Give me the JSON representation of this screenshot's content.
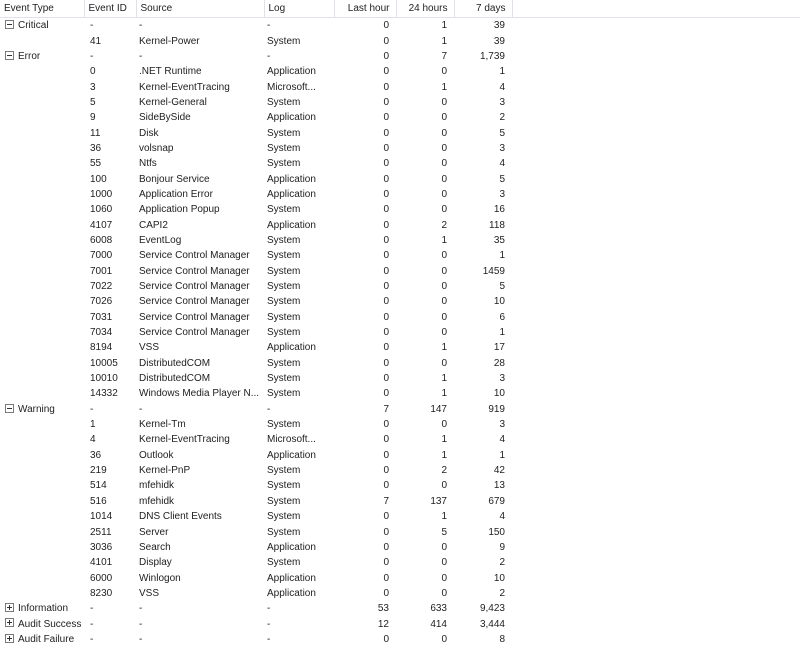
{
  "columns": [
    "Event Type",
    "Event ID",
    "Source",
    "Log",
    "Last hour",
    "24 hours",
    "7 days"
  ],
  "groups": [
    {
      "type": "Critical",
      "expanded": true,
      "summary": {
        "id": "-",
        "source": "-",
        "log": "-",
        "last_hour": "0",
        "h24": "1",
        "d7": "39"
      },
      "rows": [
        {
          "id": "41",
          "source": "Kernel-Power",
          "log": "System",
          "last_hour": "0",
          "h24": "1",
          "d7": "39"
        }
      ]
    },
    {
      "type": "Error",
      "expanded": true,
      "summary": {
        "id": "-",
        "source": "-",
        "log": "-",
        "last_hour": "0",
        "h24": "7",
        "d7": "1,739"
      },
      "rows": [
        {
          "id": "0",
          "source": ".NET Runtime",
          "log": "Application",
          "last_hour": "0",
          "h24": "0",
          "d7": "1"
        },
        {
          "id": "3",
          "source": "Kernel-EventTracing",
          "log": "Microsoft...",
          "last_hour": "0",
          "h24": "1",
          "d7": "4"
        },
        {
          "id": "5",
          "source": "Kernel-General",
          "log": "System",
          "last_hour": "0",
          "h24": "0",
          "d7": "3"
        },
        {
          "id": "9",
          "source": "SideBySide",
          "log": "Application",
          "last_hour": "0",
          "h24": "0",
          "d7": "2"
        },
        {
          "id": "11",
          "source": "Disk",
          "log": "System",
          "last_hour": "0",
          "h24": "0",
          "d7": "5"
        },
        {
          "id": "36",
          "source": "volsnap",
          "log": "System",
          "last_hour": "0",
          "h24": "0",
          "d7": "3"
        },
        {
          "id": "55",
          "source": "Ntfs",
          "log": "System",
          "last_hour": "0",
          "h24": "0",
          "d7": "4"
        },
        {
          "id": "100",
          "source": "Bonjour Service",
          "log": "Application",
          "last_hour": "0",
          "h24": "0",
          "d7": "5"
        },
        {
          "id": "1000",
          "source": "Application Error",
          "log": "Application",
          "last_hour": "0",
          "h24": "0",
          "d7": "3"
        },
        {
          "id": "1060",
          "source": "Application Popup",
          "log": "System",
          "last_hour": "0",
          "h24": "0",
          "d7": "16"
        },
        {
          "id": "4107",
          "source": "CAPI2",
          "log": "Application",
          "last_hour": "0",
          "h24": "2",
          "d7": "118"
        },
        {
          "id": "6008",
          "source": "EventLog",
          "log": "System",
          "last_hour": "0",
          "h24": "1",
          "d7": "35"
        },
        {
          "id": "7000",
          "source": "Service Control Manager",
          "log": "System",
          "last_hour": "0",
          "h24": "0",
          "d7": "1"
        },
        {
          "id": "7001",
          "source": "Service Control Manager",
          "log": "System",
          "last_hour": "0",
          "h24": "0",
          "d7": "1459"
        },
        {
          "id": "7022",
          "source": "Service Control Manager",
          "log": "System",
          "last_hour": "0",
          "h24": "0",
          "d7": "5"
        },
        {
          "id": "7026",
          "source": "Service Control Manager",
          "log": "System",
          "last_hour": "0",
          "h24": "0",
          "d7": "10"
        },
        {
          "id": "7031",
          "source": "Service Control Manager",
          "log": "System",
          "last_hour": "0",
          "h24": "0",
          "d7": "6"
        },
        {
          "id": "7034",
          "source": "Service Control Manager",
          "log": "System",
          "last_hour": "0",
          "h24": "0",
          "d7": "1"
        },
        {
          "id": "8194",
          "source": "VSS",
          "log": "Application",
          "last_hour": "0",
          "h24": "1",
          "d7": "17"
        },
        {
          "id": "10005",
          "source": "DistributedCOM",
          "log": "System",
          "last_hour": "0",
          "h24": "0",
          "d7": "28"
        },
        {
          "id": "10010",
          "source": "DistributedCOM",
          "log": "System",
          "last_hour": "0",
          "h24": "1",
          "d7": "3"
        },
        {
          "id": "14332",
          "source": "Windows Media Player N...",
          "log": "System",
          "last_hour": "0",
          "h24": "1",
          "d7": "10"
        }
      ]
    },
    {
      "type": "Warning",
      "expanded": true,
      "summary": {
        "id": "-",
        "source": "-",
        "log": "-",
        "last_hour": "7",
        "h24": "147",
        "d7": "919"
      },
      "rows": [
        {
          "id": "1",
          "source": "Kernel-Tm",
          "log": "System",
          "last_hour": "0",
          "h24": "0",
          "d7": "3"
        },
        {
          "id": "4",
          "source": "Kernel-EventTracing",
          "log": "Microsoft...",
          "last_hour": "0",
          "h24": "1",
          "d7": "4"
        },
        {
          "id": "36",
          "source": "Outlook",
          "log": "Application",
          "last_hour": "0",
          "h24": "1",
          "d7": "1"
        },
        {
          "id": "219",
          "source": "Kernel-PnP",
          "log": "System",
          "last_hour": "0",
          "h24": "2",
          "d7": "42"
        },
        {
          "id": "514",
          "source": "mfehidk",
          "log": "System",
          "last_hour": "0",
          "h24": "0",
          "d7": "13"
        },
        {
          "id": "516",
          "source": "mfehidk",
          "log": "System",
          "last_hour": "7",
          "h24": "137",
          "d7": "679"
        },
        {
          "id": "1014",
          "source": "DNS Client Events",
          "log": "System",
          "last_hour": "0",
          "h24": "1",
          "d7": "4"
        },
        {
          "id": "2511",
          "source": "Server",
          "log": "System",
          "last_hour": "0",
          "h24": "5",
          "d7": "150"
        },
        {
          "id": "3036",
          "source": "Search",
          "log": "Application",
          "last_hour": "0",
          "h24": "0",
          "d7": "9"
        },
        {
          "id": "4101",
          "source": "Display",
          "log": "System",
          "last_hour": "0",
          "h24": "0",
          "d7": "2"
        },
        {
          "id": "6000",
          "source": "Winlogon",
          "log": "Application",
          "last_hour": "0",
          "h24": "0",
          "d7": "10"
        },
        {
          "id": "8230",
          "source": "VSS",
          "log": "Application",
          "last_hour": "0",
          "h24": "0",
          "d7": "2"
        }
      ]
    },
    {
      "type": "Information",
      "expanded": false,
      "summary": {
        "id": "-",
        "source": "-",
        "log": "-",
        "last_hour": "53",
        "h24": "633",
        "d7": "9,423"
      },
      "rows": []
    },
    {
      "type": "Audit Success",
      "expanded": false,
      "summary": {
        "id": "-",
        "source": "-",
        "log": "-",
        "last_hour": "12",
        "h24": "414",
        "d7": "3,444"
      },
      "rows": []
    },
    {
      "type": "Audit Failure",
      "expanded": false,
      "summary": {
        "id": "-",
        "source": "-",
        "log": "-",
        "last_hour": "0",
        "h24": "0",
        "d7": "8"
      },
      "rows": []
    }
  ]
}
